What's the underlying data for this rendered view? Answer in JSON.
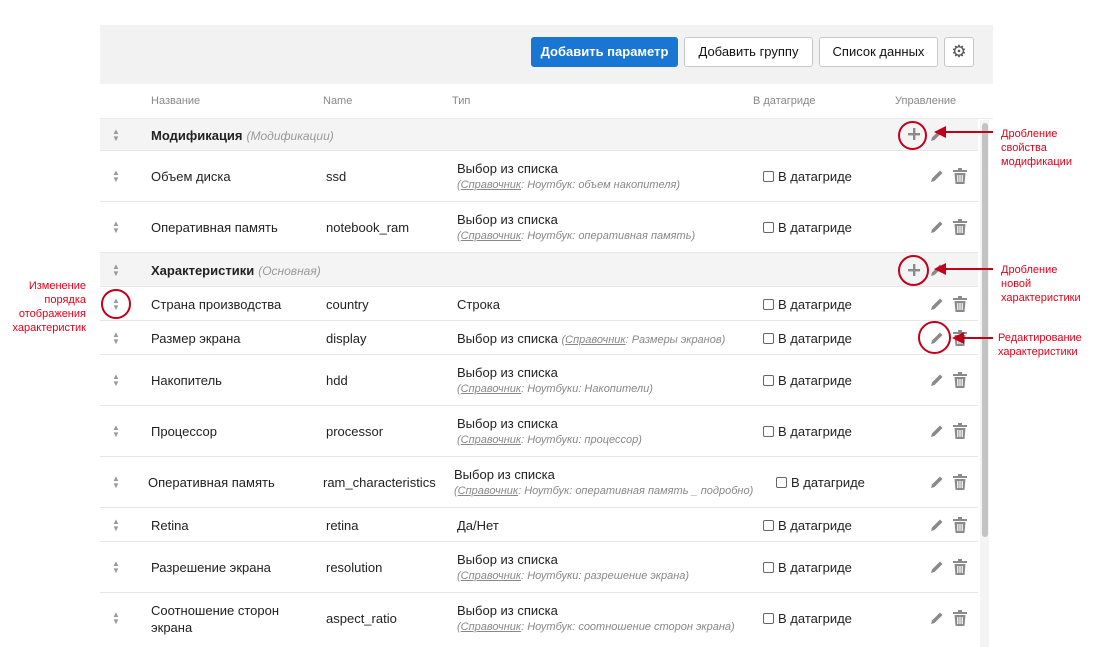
{
  "toolbar": {
    "add_param": "Добавить параметр",
    "add_group": "Добавить группу",
    "data_list": "Список данных",
    "settings_icon": "gear-icon"
  },
  "header": {
    "name": "Название",
    "code": "Name",
    "type": "Тип",
    "datagrid": "В датагриде",
    "manage": "Управление"
  },
  "groups": [
    {
      "title": "Модификация",
      "subtitle": "(Модификации)"
    },
    {
      "title": "Характеристики",
      "subtitle": "(Основная)"
    }
  ],
  "rows": [
    {
      "name": "Объем диска",
      "code": "ssd",
      "type": "Выбор из списка",
      "ref": "Справочник",
      "ref_rest": ": Ноутбук: объем накопителя)",
      "datagrid": "В датагриде"
    },
    {
      "name": "Оперативная память",
      "code": "notebook_ram",
      "type": "Выбор из списка",
      "ref": "Справочник",
      "ref_rest": ": Ноутбук: оперативная память)",
      "datagrid": "В датагриде"
    },
    {
      "name": "Страна производства",
      "code": "country",
      "type": "Строка",
      "datagrid": "В датагриде"
    },
    {
      "name": "Размер экрана",
      "code": "display",
      "type": "Выбор из списка",
      "ref": "Справочник",
      "ref_rest": ": Размеры экранов)",
      "datagrid": "В датагриде"
    },
    {
      "name": "Накопитель",
      "code": "hdd",
      "type": "Выбор из списка",
      "ref": "Справочник",
      "ref_rest": ": Ноутбуки: Накопители)",
      "datagrid": "В датагриде"
    },
    {
      "name": "Процессор",
      "code": "processor",
      "type": "Выбор из списка",
      "ref": "Справочник",
      "ref_rest": ": Ноутбуки: процессор)",
      "datagrid": "В датагриде"
    },
    {
      "name": "Оперативная память",
      "code": "ram_characteristics",
      "type": "Выбор из списка",
      "ref": "Справочник",
      "ref_rest": ": Ноутбук: оперативная память _ подробно)",
      "datagrid": "В датагриде"
    },
    {
      "name": "Retina",
      "code": "retina",
      "type": "Да/Нет",
      "datagrid": "В датагриде"
    },
    {
      "name": "Разрешение экрана",
      "code": "resolution",
      "type": "Выбор из списка",
      "ref": "Справочник",
      "ref_rest": ": Ноутбуки: разрешение экрана)",
      "datagrid": "В датагриде"
    },
    {
      "name_line1": "Соотношение сторон",
      "name_line2": "экрана",
      "code": "aspect_ratio",
      "type": "Выбор из списка",
      "ref": "Справочник",
      "ref_rest": ": Ноутбук: соотношение сторон экрана)",
      "datagrid": "В датагриде"
    }
  ],
  "annotations": {
    "split_modification": [
      "Дробление",
      "свойства",
      "модификации"
    ],
    "split_new": [
      "Дробление",
      "новой",
      "характеристики"
    ],
    "edit": [
      "Редактирование",
      "характеристики"
    ],
    "reorder": [
      "Изменение",
      "порядка",
      "отображения",
      "характеристик"
    ]
  },
  "colors": {
    "accent": "#1976d2",
    "annotation": "#e0001b",
    "ring": "#c1001b"
  }
}
